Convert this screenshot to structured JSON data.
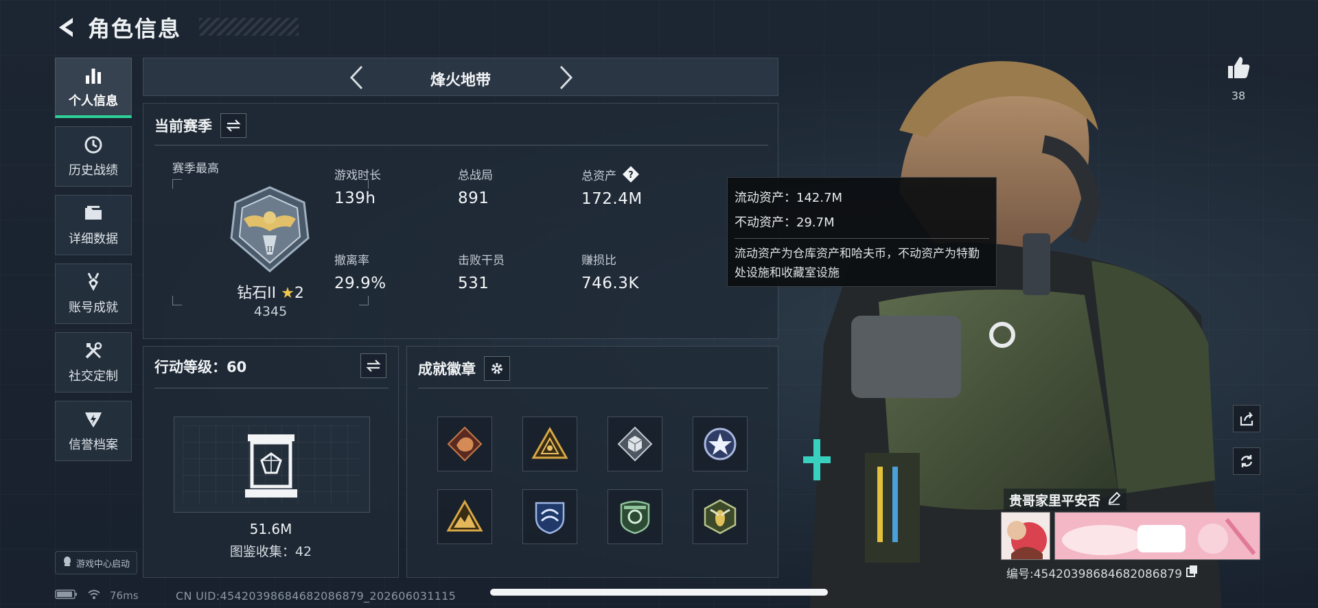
{
  "header": {
    "title": "角色信息"
  },
  "sidebar": {
    "items": [
      {
        "label": "个人信息",
        "icon": "bar-chart-icon",
        "active": true
      },
      {
        "label": "历史战绩",
        "icon": "clock-icon"
      },
      {
        "label": "详细数据",
        "icon": "folder-icon"
      },
      {
        "label": "账号成就",
        "icon": "medal-icon"
      },
      {
        "label": "社交定制",
        "icon": "tools-icon"
      },
      {
        "label": "信誉档案",
        "icon": "shield-bolt-icon"
      }
    ],
    "launch_label": "游戏中心启动"
  },
  "mode": {
    "title": "烽火地带"
  },
  "season": {
    "title": "当前赛季",
    "best_label": "赛季最高",
    "rank_name": "钻石II",
    "rank_stars": "2",
    "rank_score": "4345",
    "stats": [
      {
        "label": "游戏时长",
        "value": "139h"
      },
      {
        "label": "总战局",
        "value": "891"
      },
      {
        "label": "总资产",
        "value": "172.4M"
      },
      {
        "label": "撤离率",
        "value": "29.9%"
      },
      {
        "label": "击败干员",
        "value": "531"
      },
      {
        "label": "赚损比",
        "value": "746.3K"
      }
    ]
  },
  "tooltip": {
    "liquid": "流动资产：142.7M",
    "fixed": "不动资产：29.7M",
    "note": "流动资产为仓库资产和哈夫币，不动资产为特勤处设施和收藏室设施"
  },
  "level": {
    "title": "行动等级：60",
    "value": "51.6M",
    "collection": "图鉴收集：42"
  },
  "badges": {
    "title": "成就徽章",
    "items": [
      "dragon-badge",
      "golden-triangle-badge",
      "cube-badge",
      "star-badge",
      "mountain-badge",
      "shield-wave-badge",
      "green-shield-badge",
      "wasp-badge"
    ]
  },
  "profile": {
    "likes": "38",
    "player_name": "贵哥家里平安否",
    "player_id": "编号:4542039868468208687​9"
  },
  "status": {
    "ping": "76ms",
    "uid": "CN UID:4542039868468208687​9_202606031115"
  },
  "colors": {
    "accent": "#2fd39a",
    "star": "#f2c84b"
  }
}
